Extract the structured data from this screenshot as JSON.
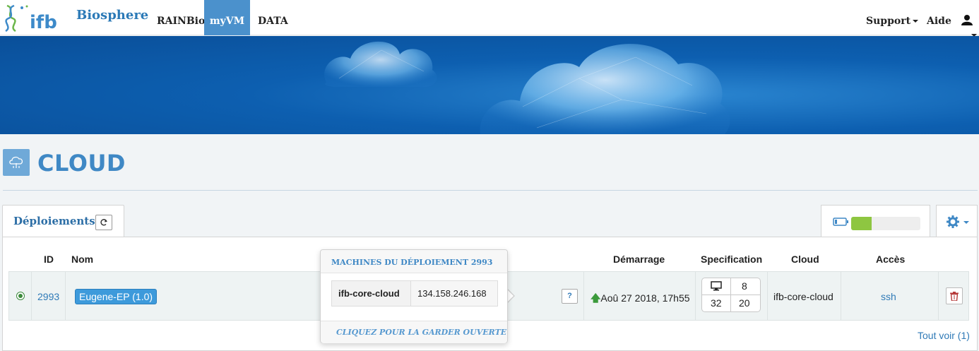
{
  "header": {
    "logo_text": "ifb",
    "brand": "Biosphere",
    "nav": [
      {
        "label": "RAINBio"
      },
      {
        "label": "myVM",
        "active": true
      },
      {
        "label": "DATA"
      }
    ],
    "right_nav": [
      {
        "label": "Support",
        "has_dropdown": true
      },
      {
        "label": "Aide"
      }
    ],
    "user_icon": "user-icon"
  },
  "page": {
    "title": "CLOUD",
    "title_icon": "cloud-upload-icon"
  },
  "deployments_tab": {
    "label": "Déploiements",
    "refresh_icon": "refresh-icon",
    "usage_level": 0.3
  },
  "settings_icon": "gear-icon",
  "table": {
    "columns": [
      "ID",
      "Nom",
      "Démarrage",
      "Specification",
      "Cloud",
      "Accès"
    ],
    "rows": [
      {
        "status": "running",
        "id": "2993",
        "name": "Eugene-EP (1.0)",
        "help": "?",
        "start": "Aoû 27 2018, 17h55",
        "spec": {
          "machines": "8",
          "cpu": "32",
          "ram": "20"
        },
        "cloud": "ifb-core-cloud",
        "access": "ssh"
      }
    ],
    "see_all": "Tout voir (1)"
  },
  "popover": {
    "title": "MACHINES DU DÉPLOIEMENT 2993",
    "machines": [
      {
        "name": "ifb-core-cloud",
        "ip": "134.158.246.168"
      }
    ],
    "footer": "CLIQUEZ POUR LA GARDER OUVERTE"
  },
  "colors": {
    "accent": "#3f88c5",
    "nav_active": "#4b91cc",
    "badge": "#3d9adb",
    "usage_fill": "#8ec641",
    "start_arrow": "#3b9a3b",
    "delete": "#b63a3a"
  }
}
